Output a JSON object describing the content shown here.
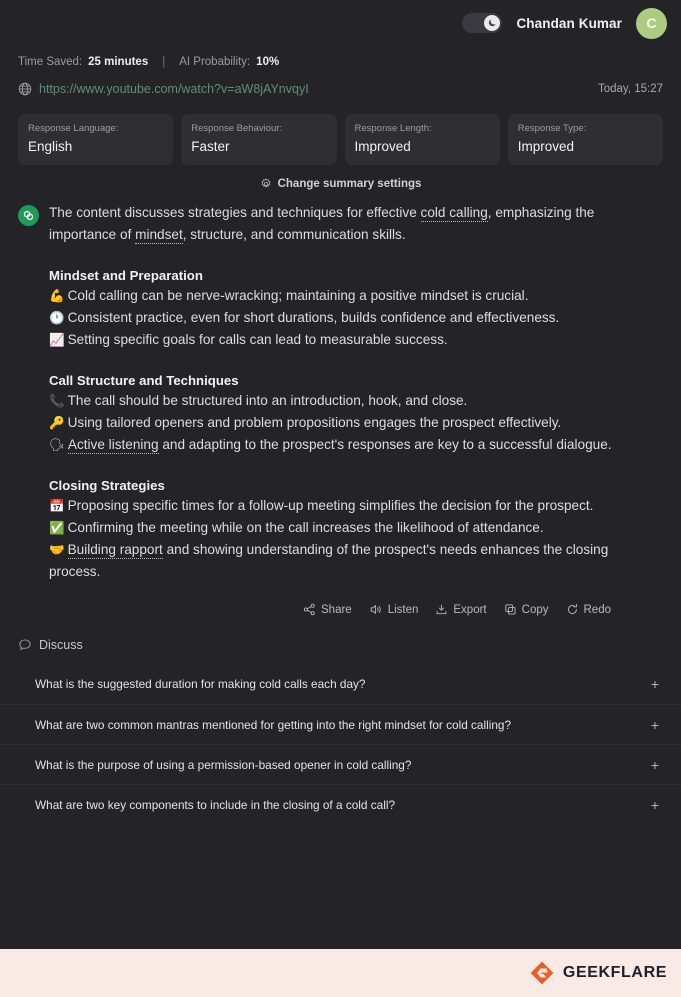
{
  "header": {
    "dark_mode_toggle": "dark-mode-toggle",
    "moon_icon": "moon-icon",
    "user_name": "Chandan Kumar",
    "avatar_initial": "C"
  },
  "meta": {
    "time_saved_label": "Time Saved:",
    "time_saved_value": "25 minutes",
    "separator": "|",
    "ai_probability_label": "AI Probability:",
    "ai_probability_value": "10%",
    "globe_icon": "globe-icon",
    "url": "https://www.youtube.com/watch?v=aW8jAYnvqyI",
    "timestamp": "Today, 15:27"
  },
  "settings_cards": [
    {
      "label": "Response Language:",
      "value": "English"
    },
    {
      "label": "Response Behaviour:",
      "value": "Faster"
    },
    {
      "label": "Response Length:",
      "value": "Improved"
    },
    {
      "label": "Response Type:",
      "value": "Improved"
    }
  ],
  "change_settings": {
    "gear_icon": "gear-icon",
    "label": "Change summary settings"
  },
  "summary": {
    "brand_icon": "geekflare-mark-icon",
    "intro_part1": "The content discusses strategies and techniques for effective ",
    "intro_link1": "cold calling",
    "intro_part2": ", emphasizing the importance of ",
    "intro_link2": "mindset",
    "intro_part3": ", structure, and communication skills.",
    "sections": [
      {
        "title": "Mindset and Preparation",
        "bullets": [
          {
            "emoji": "💪",
            "emoji_name": "flexed-biceps-emoji",
            "text": "Cold calling can be nerve-wracking; maintaining a positive mindset is crucial."
          },
          {
            "emoji": "🕐",
            "emoji_name": "clock-emoji",
            "text": "Consistent practice, even for short durations, builds confidence and effectiveness."
          },
          {
            "emoji": "📈",
            "emoji_name": "chart-increasing-emoji",
            "text": "Setting specific goals for calls can lead to measurable success."
          }
        ]
      },
      {
        "title": "Call Structure and Techniques",
        "bullets": [
          {
            "emoji": "📞",
            "emoji_name": "telephone-receiver-emoji",
            "text": "The call should be structured into an introduction, hook, and close."
          },
          {
            "emoji": "🔑",
            "emoji_name": "key-emoji",
            "text": "Using tailored openers and problem propositions engages the prospect effectively."
          },
          {
            "emoji": "🗣",
            "emoji_name": "speaking-head-emoji",
            "link": "Active listening",
            "text": " and adapting to the prospect's responses are key to a successful dialogue."
          }
        ]
      },
      {
        "title": "Closing Strategies",
        "bullets": [
          {
            "emoji": "📅",
            "emoji_name": "calendar-emoji",
            "text": "Proposing specific times for a follow-up meeting simplifies the decision for the prospect."
          },
          {
            "emoji": "✅",
            "emoji_name": "check-mark-emoji",
            "text": "Confirming the meeting while on the call increases the likelihood of attendance."
          },
          {
            "emoji": "🤝",
            "emoji_name": "handshake-emoji",
            "link": "Building rapport",
            "text": " and showing understanding of the prospect's needs enhances the closing process."
          }
        ]
      }
    ]
  },
  "actions": [
    {
      "label": "Share",
      "icon": "share-icon"
    },
    {
      "label": "Listen",
      "icon": "speaker-icon"
    },
    {
      "label": "Export",
      "icon": "export-icon"
    },
    {
      "label": "Copy",
      "icon": "copy-icon"
    },
    {
      "label": "Redo",
      "icon": "redo-icon"
    }
  ],
  "discuss": {
    "icon": "chat-bubble-icon",
    "label": "Discuss",
    "questions": [
      {
        "text": "What is the suggested duration for making cold calls each day?",
        "expand": "+"
      },
      {
        "text": "What are two common mantras mentioned for getting into the right mindset for cold calling?",
        "expand": "+"
      },
      {
        "text": "What is the purpose of using a permission-based opener in cold calling?",
        "expand": "+"
      },
      {
        "text": "What are two key components to include in the closing of a cold call?",
        "expand": "+"
      }
    ]
  },
  "footer": {
    "logo_icon": "geekflare-logo-icon",
    "brand": "GEEKFLARE"
  },
  "colors": {
    "background": "#242428",
    "card": "#2e2e33",
    "accent_green": "#1f9b57",
    "link_green": "#5f8f74",
    "avatar": "#adcc82",
    "footer_bg": "#faeae6",
    "brand_orange": "#ef5b25"
  }
}
